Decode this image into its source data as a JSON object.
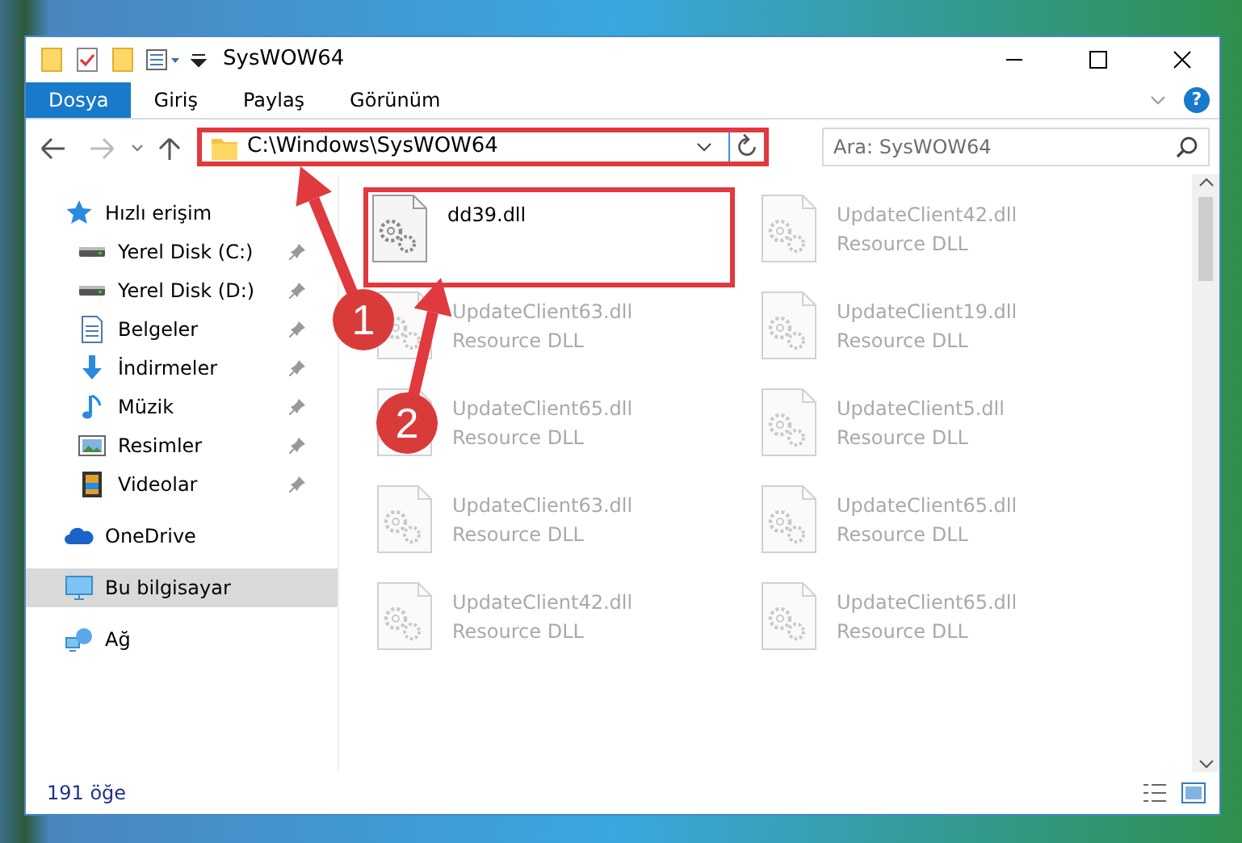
{
  "window": {
    "title": "SysWOW64"
  },
  "ribbon": {
    "tabs": [
      {
        "label": "Dosya",
        "selected": true
      },
      {
        "label": "Giriş",
        "selected": false
      },
      {
        "label": "Paylaş",
        "selected": false
      },
      {
        "label": "Görünüm",
        "selected": false
      }
    ],
    "help": "?"
  },
  "address_bar": {
    "path": "C:\\Windows\\SysWOW64",
    "highlighted": true
  },
  "search": {
    "placeholder": "Ara: SysWOW64"
  },
  "sidebar": {
    "items": [
      {
        "label": "Hızlı erişim",
        "kind": "star",
        "selected": false,
        "children": [
          {
            "label": "Yerel Disk (C:)",
            "kind": "drive",
            "pinned": true,
            "selected": false
          },
          {
            "label": "Yerel Disk (D:)",
            "kind": "drive",
            "pinned": true,
            "selected": false
          },
          {
            "label": "Belgeler",
            "kind": "document",
            "pinned": true,
            "selected": false
          },
          {
            "label": "İndirmeler",
            "kind": "download",
            "pinned": true,
            "selected": false
          },
          {
            "label": "Müzik",
            "kind": "music",
            "pinned": true,
            "selected": false
          },
          {
            "label": "Resimler",
            "kind": "picture",
            "pinned": true,
            "selected": false
          },
          {
            "label": "Videolar",
            "kind": "video",
            "pinned": true,
            "selected": false
          }
        ]
      },
      {
        "label": "OneDrive",
        "kind": "cloud",
        "selected": false
      },
      {
        "label": "Bu bilgisayar",
        "kind": "computer",
        "selected": true
      },
      {
        "label": "Ağ",
        "kind": "network",
        "selected": false
      }
    ]
  },
  "files": [
    {
      "name": "dd39.dll",
      "highlighted": true,
      "blurred": false
    },
    {
      "name": "UpdateClient42.dll",
      "type": "Resource DLL",
      "highlighted": false,
      "blurred": true
    },
    {
      "name": "UpdateClient63.dll",
      "type": "Resource DLL",
      "highlighted": false,
      "blurred": true
    },
    {
      "name": "UpdateClient19.dll",
      "type": "Resource DLL",
      "highlighted": false,
      "blurred": true
    },
    {
      "name": "UpdateClient65.dll",
      "type": "Resource DLL",
      "highlighted": false,
      "blurred": true
    },
    {
      "name": "UpdateClient5.dll",
      "type": "Resource DLL",
      "highlighted": false,
      "blurred": true
    },
    {
      "name": "UpdateClient63.dll",
      "type": "Resource DLL",
      "highlighted": false,
      "blurred": true
    },
    {
      "name": "UpdateClient65.dll",
      "type": "Resource DLL",
      "highlighted": false,
      "blurred": true
    },
    {
      "name": "UpdateClient42.dll",
      "type": "Resource DLL",
      "highlighted": false,
      "blurred": true
    },
    {
      "name": "UpdateClient65.dll",
      "type": "Resource DLL",
      "highlighted": false,
      "blurred": true
    }
  ],
  "status_bar": {
    "count": "191 öğe"
  },
  "annotations": [
    {
      "number": "1"
    },
    {
      "number": "2"
    }
  ]
}
